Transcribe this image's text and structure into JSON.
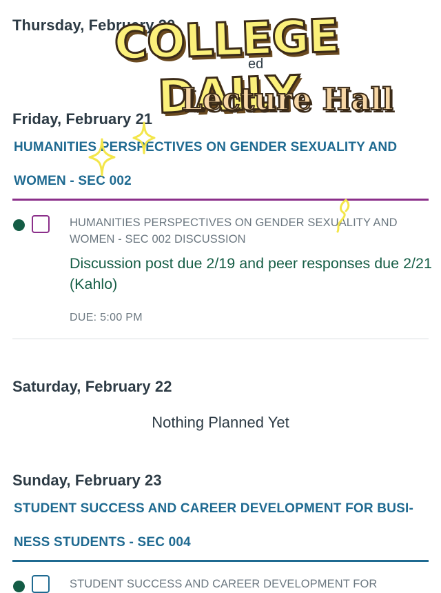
{
  "overlay": {
    "title": "COLLEGE DAILY",
    "subtitle": "Lecture Hall"
  },
  "days": {
    "thursday": {
      "heading": "Thursday, February 20"
    },
    "friday": {
      "heading": "Friday, February 21",
      "course_title": "HUMANITIES PERSPECTIVES ON GENDER SEXUALITY AND WOMEN - SEC 002",
      "course_color": "#8b2f8a",
      "item": {
        "course": "HUMANITIES PERSPECTIVES ON GENDER SEXUALITY AND WOMEN - SEC 002 DISCUSSION",
        "title": "Discussion post due 2/19 and peer responses due 2/21 (Kahlo)",
        "due": "DUE: 5:00 PM"
      }
    },
    "saturday": {
      "heading": "Saturday, February 22",
      "empty_text": "Nothing Planned Yet"
    },
    "sunday": {
      "heading": "Sunday, February 23",
      "course_title": "STUDENT SUCCESS AND CAREER DEVELOPMENT FOR BUSI-NESS STUDENTS - SEC 004",
      "course_color": "#1f6a91",
      "item": {
        "course": "STUDENT SUCCESS AND CAREER DEVELOPMENT FOR"
      }
    }
  },
  "colors": {
    "link_blue": "#1f6a91",
    "done_green": "#145c45",
    "purple": "#8b2f8a",
    "banner_yellow": "#fbf07a"
  }
}
